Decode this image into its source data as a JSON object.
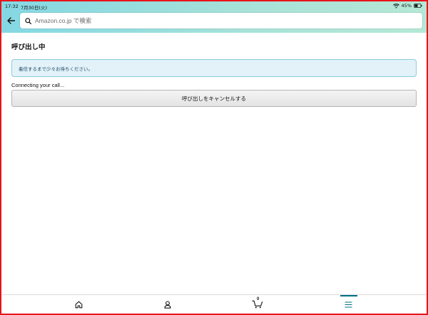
{
  "status": {
    "time": "17:32",
    "date": "7月30日(火)",
    "battery": "45%"
  },
  "search": {
    "placeholder": "Amazon.co.jp で検索"
  },
  "main": {
    "title": "呼び出し中",
    "alert_text": "着信するまで少々お待ちください。",
    "connecting_text": "Connecting your call...",
    "cancel_label": "呼び出しをキャンセルする"
  },
  "bottom_nav": {
    "cart_count": "0",
    "active_tab": "menu"
  },
  "colors": {
    "accent": "#007185",
    "border": "#e8141b",
    "alert_bg": "#e2f2f8",
    "alert_border": "#8dc9df"
  },
  "icons": {
    "back": "arrow-left-icon",
    "search": "search-icon",
    "home": "home-icon",
    "account": "person-icon",
    "cart": "cart-icon",
    "menu": "hamburger-icon",
    "wifi": "wifi-icon",
    "battery": "battery-icon"
  }
}
